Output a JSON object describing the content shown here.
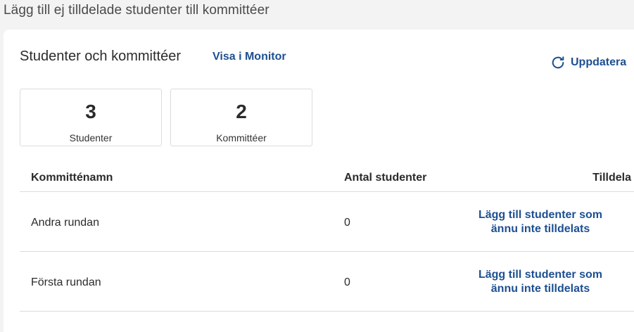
{
  "page": {
    "title": "Lägg till ej tilldelade studenter till kommittéer"
  },
  "card": {
    "title": "Studenter och kommittéer",
    "monitor_link": "Visa i Monitor",
    "refresh": {
      "label": "Uppdatera",
      "icon": "refresh-icon"
    }
  },
  "stats": [
    {
      "value": "3",
      "label": "Studenter"
    },
    {
      "value": "2",
      "label": "Kommittéer"
    }
  ],
  "table": {
    "headers": {
      "name": "Kommitténamn",
      "count": "Antal studenter",
      "assign": "Tilldela"
    },
    "rows": [
      {
        "name": "Andra rundan",
        "count": "0",
        "assign_line1": "Lägg till studenter som",
        "assign_line2": "ännu inte tilldelats"
      },
      {
        "name": "Första rundan",
        "count": "0",
        "assign_line1": "Lägg till studenter som",
        "assign_line2": "ännu inte tilldelats"
      }
    ]
  },
  "colors": {
    "link": "#1d4f91",
    "border": "#dcdcdc",
    "background": "#f3f3f3"
  }
}
